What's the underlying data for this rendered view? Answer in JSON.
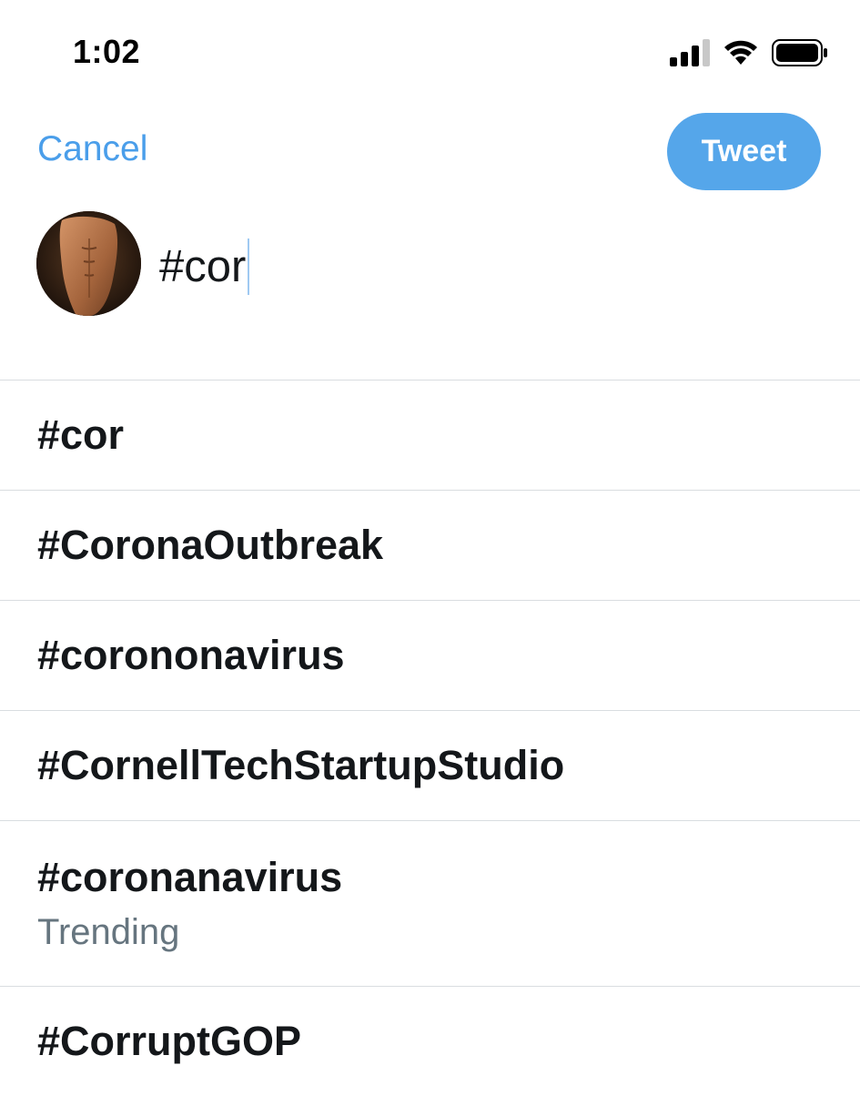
{
  "status_bar": {
    "time": "1:02",
    "icons": [
      "signal-icon",
      "wifi-icon",
      "battery-icon"
    ]
  },
  "header": {
    "cancel_label": "Cancel",
    "tweet_label": "Tweet"
  },
  "compose": {
    "text": "#cor"
  },
  "suggestions": [
    {
      "tag": "#cor",
      "sub": ""
    },
    {
      "tag": "#CoronaOutbreak",
      "sub": ""
    },
    {
      "tag": "#corononavirus",
      "sub": ""
    },
    {
      "tag": "#CornellTechStartupStudio",
      "sub": ""
    },
    {
      "tag": "#coronanavirus",
      "sub": "Trending"
    },
    {
      "tag": "#CorruptGOP",
      "sub": ""
    }
  ],
  "colors": {
    "accent": "#4a9eea",
    "tweet_button": "#55a6ea",
    "text_primary": "#14171a",
    "text_secondary": "#66757f",
    "divider": "#d9dde0"
  }
}
